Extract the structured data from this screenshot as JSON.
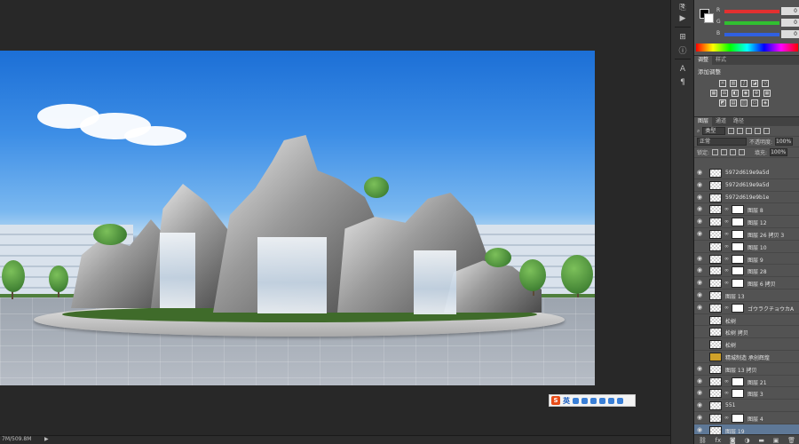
{
  "status": {
    "doc_size": "7M/509.8M"
  },
  "ime_toolbar": {
    "lang_label": "英"
  },
  "color_panel": {
    "channels": [
      {
        "label": "R",
        "value": "0",
        "bar": "#e33030"
      },
      {
        "label": "G",
        "value": "0",
        "bar": "#30c030"
      },
      {
        "label": "B",
        "value": "0",
        "bar": "#3060e0"
      }
    ]
  },
  "adjust_panel": {
    "tabs": [
      "调整",
      "样式"
    ],
    "title": "添加调整"
  },
  "layers_panel": {
    "tabs": [
      "图层",
      "通道",
      "路径"
    ],
    "filter_label": "类型",
    "blend_mode": "正常",
    "opacity_label": "不透明度:",
    "opacity_value": "100%",
    "lock_label": "锁定:",
    "fill_label": "填充:",
    "fill_value": "100%",
    "layers": [
      {
        "name": "5972d619e9a5d",
        "eye": true,
        "mask": false,
        "selected": false
      },
      {
        "name": "5972d619e9a5d",
        "eye": true,
        "mask": false,
        "selected": false
      },
      {
        "name": "5972d619e9b1e",
        "eye": true,
        "mask": false,
        "selected": false
      },
      {
        "name": "图层 8",
        "eye": true,
        "mask": true,
        "selected": false
      },
      {
        "name": "图层 12",
        "eye": true,
        "mask": true,
        "selected": false
      },
      {
        "name": "图层 26 拷贝 3",
        "eye": true,
        "mask": true,
        "selected": false
      },
      {
        "name": "图层 10",
        "eye": false,
        "mask": true,
        "selected": false
      },
      {
        "name": "图层 9",
        "eye": true,
        "mask": true,
        "selected": false
      },
      {
        "name": "图层 28",
        "eye": true,
        "mask": true,
        "selected": false
      },
      {
        "name": "图层 6 拷贝",
        "eye": true,
        "mask": true,
        "selected": false
      },
      {
        "name": "图层 13",
        "eye": true,
        "mask": false,
        "selected": false
      },
      {
        "name": "ゴウラクチョウカA",
        "eye": true,
        "mask": true,
        "selected": false
      },
      {
        "name": "松树",
        "eye": false,
        "mask": false,
        "selected": false
      },
      {
        "name": "松树 拷贝",
        "eye": false,
        "mask": false,
        "selected": false
      },
      {
        "name": "松树",
        "eye": false,
        "mask": false,
        "selected": false
      },
      {
        "name": "精城制造  承创辉煌",
        "eye": false,
        "mask": false,
        "selected": false,
        "type_layer": true
      },
      {
        "name": "图层 13 拷贝",
        "eye": true,
        "mask": false,
        "selected": false
      },
      {
        "name": "图层 21",
        "eye": true,
        "mask": true,
        "selected": false
      },
      {
        "name": "图层 3",
        "eye": true,
        "mask": true,
        "selected": false
      },
      {
        "name": "551",
        "eye": true,
        "mask": false,
        "selected": false
      },
      {
        "name": "图层 4",
        "eye": true,
        "mask": true,
        "selected": false
      },
      {
        "name": "图层 19",
        "eye": true,
        "mask": false,
        "selected": true
      }
    ]
  }
}
